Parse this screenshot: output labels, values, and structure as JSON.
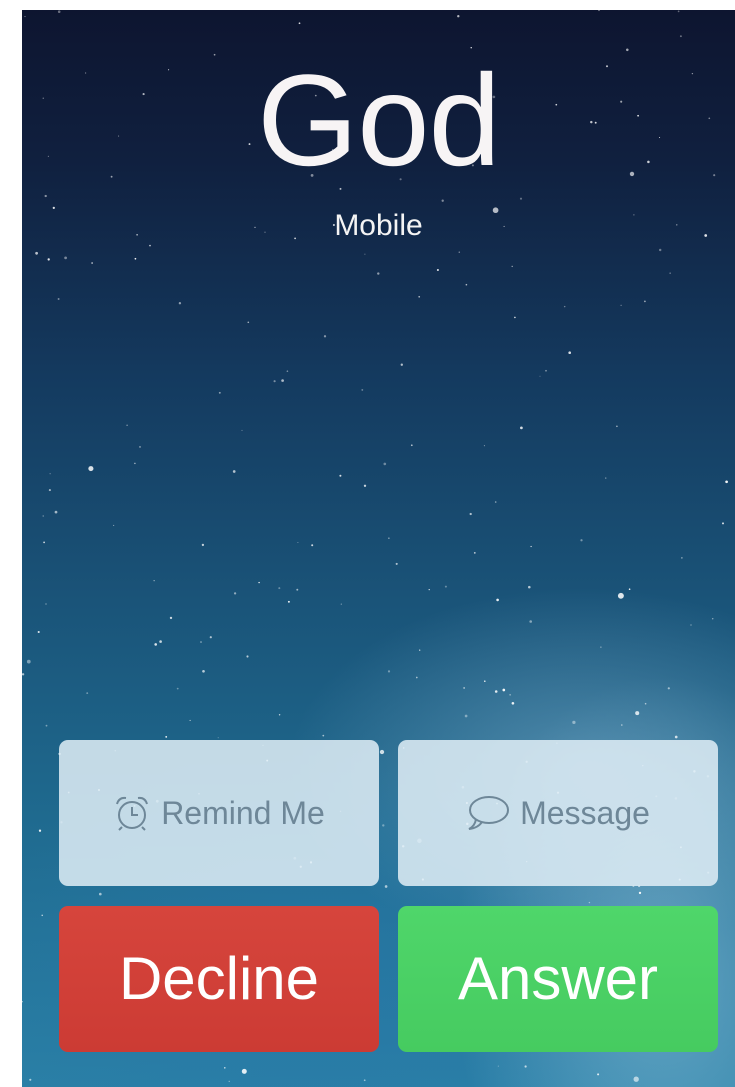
{
  "caller": {
    "name": "God",
    "type": "Mobile"
  },
  "actions": {
    "remind_label": "Remind Me",
    "remind_icon": "alarm-clock-icon",
    "message_label": "Message",
    "message_icon": "speech-bubble-icon",
    "decline_label": "Decline",
    "answer_label": "Answer"
  },
  "colors": {
    "decline": "#d1403a",
    "answer": "#4bd165",
    "secondary_button_bg": "#e0eef6",
    "secondary_button_text": "#6e8798"
  }
}
